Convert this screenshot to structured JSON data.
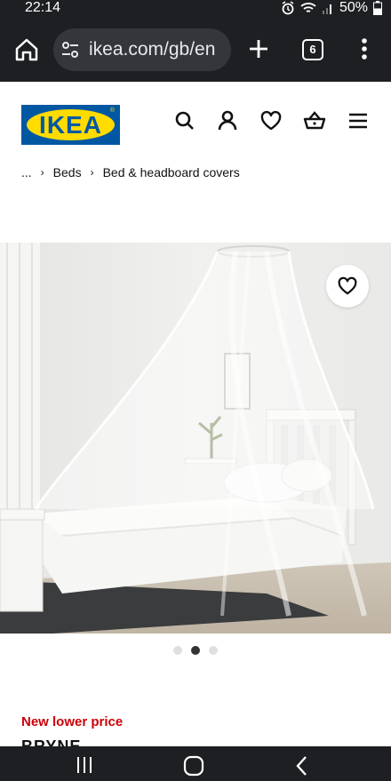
{
  "status_bar": {
    "time": "22:14",
    "battery": "50%",
    "icons": [
      "alarm-icon",
      "wifi-icon",
      "signal-icon",
      "battery-icon"
    ]
  },
  "browser": {
    "url": "ikea.com/gb/en",
    "tab_count": "6",
    "icons": [
      "home-icon",
      "site-settings-icon",
      "new-tab-icon",
      "tabs-icon",
      "more-icon"
    ]
  },
  "header": {
    "logo_text": "IKEA",
    "logo_mark": "®",
    "icons": [
      "search-icon",
      "account-icon",
      "favourites-icon",
      "basket-icon",
      "menu-icon"
    ]
  },
  "breadcrumb": {
    "items": [
      "...",
      "Beds",
      "Bed & headboard covers"
    ]
  },
  "gallery": {
    "image": "Bed canopy over white single bed",
    "dot_count": 3,
    "active_index": 1
  },
  "product": {
    "price_tag": "New lower price",
    "name": "BRYNE"
  },
  "colors": {
    "ikea_blue": "#0058a3",
    "ikea_yellow": "#ffdb00",
    "price_red": "#cc0008",
    "browser_dark": "#1e1f23"
  }
}
